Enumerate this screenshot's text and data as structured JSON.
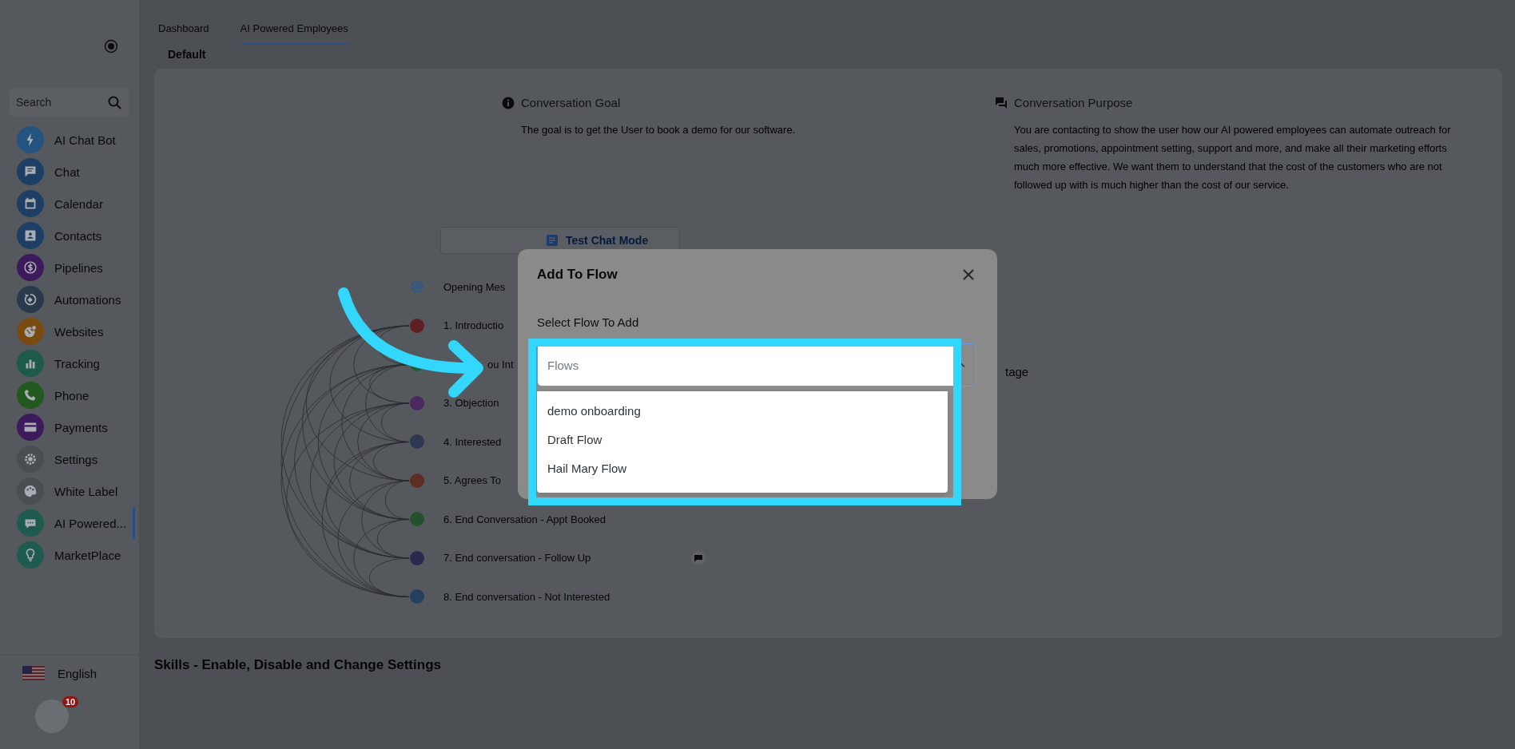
{
  "sidebar": {
    "search": {
      "placeholder": "Search"
    },
    "items": [
      {
        "label": "AI Chat Bot",
        "color": "#24537f",
        "selected": false
      },
      {
        "label": "Chat",
        "color": "#1d3f66",
        "selected": false
      },
      {
        "label": "Calendar",
        "color": "#1d3f66",
        "selected": false
      },
      {
        "label": "Contacts",
        "color": "#1d3f66",
        "selected": false
      },
      {
        "label": "Pipelines",
        "color": "#3d1a5c",
        "selected": false
      },
      {
        "label": "Automations",
        "color": "#2a3a4c",
        "selected": false
      },
      {
        "label": "Websites",
        "color": "#7a4a10",
        "selected": false
      },
      {
        "label": "Tracking",
        "color": "#1d5a4c",
        "selected": false
      },
      {
        "label": "Phone",
        "color": "#21591f",
        "selected": false
      },
      {
        "label": "Payments",
        "color": "#3d1a5c",
        "selected": false
      },
      {
        "label": "Settings",
        "color": "#4a4d52",
        "selected": false
      },
      {
        "label": "White Label",
        "color": "#4a4d52",
        "selected": false
      },
      {
        "label": "AI Powered...",
        "color": "#1f5a4e",
        "selected": true
      },
      {
        "label": "MarketPlace",
        "color": "#1f5a4e",
        "selected": false
      }
    ],
    "language": "English",
    "notification_count": "10"
  },
  "tabs": [
    {
      "label": "Dashboard",
      "selected": false
    },
    {
      "label": "AI Powered Employees",
      "selected": true
    }
  ],
  "subtab": "Default",
  "goal": {
    "title": "Conversation Goal",
    "text": "The goal is to get the User to book a demo for our software."
  },
  "purpose": {
    "title": "Conversation Purpose",
    "text": "You are contacting to show the user how our AI powered employees can automate outreach for sales, promotions, appointment setting, support and more, and make all their marketing efforts much more effective. We want them to understand that the cost of the customers who are not followed up with is much higher than the cost of our service."
  },
  "test_chat_button": "Test Chat Mode",
  "stages": [
    {
      "label": "Opening Mes",
      "kind": "opening",
      "color": "#2c5a8a",
      "note": false
    },
    {
      "label": "1. Introductio",
      "kind": "step",
      "color": "#5e1f22",
      "note": false
    },
    {
      "label": "ou Int",
      "kind": "covered",
      "color": "#245a35",
      "note": false
    },
    {
      "label": "3. Objection",
      "kind": "step",
      "color": "#4a2a5e",
      "note": false
    },
    {
      "label": "4. Interested",
      "kind": "step",
      "color": "#2e3850",
      "note": false
    },
    {
      "label": "5. Agrees To",
      "kind": "step",
      "color": "#5e2e22",
      "note": false
    },
    {
      "label": "6. End Conversation - Appt Booked",
      "kind": "step",
      "color": "#24502e",
      "note": false
    },
    {
      "label": "7. End conversation - Follow Up",
      "kind": "step",
      "color": "#2a2a50",
      "note": true
    },
    {
      "label": "8. End conversation - Not Interested",
      "kind": "step",
      "color": "#25405e",
      "note": false
    }
  ],
  "column_3_text": "tage",
  "skills_heading": "Skills - Enable, Disable and Change Settings",
  "modal": {
    "title": "Add To Flow",
    "label": "Select Flow To Add",
    "placeholder": "Flows",
    "options": [
      "demo onboarding",
      "Draft Flow",
      "Hail Mary Flow"
    ]
  }
}
